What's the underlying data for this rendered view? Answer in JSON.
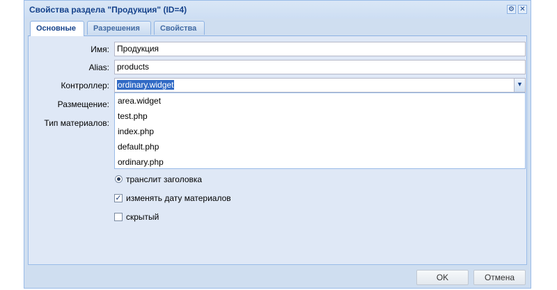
{
  "window": {
    "title": "Свойства раздела \"Продукция\" (ID=4)",
    "tools": {
      "gear": "⚙",
      "close": "✕"
    }
  },
  "tabs": [
    {
      "label": "Основные",
      "active": true
    },
    {
      "label": "Разрешения",
      "active": false
    },
    {
      "label": "Свойства",
      "active": false
    }
  ],
  "form": {
    "name_label": "Имя:",
    "name_value": "Продукция",
    "alias_label": "Alias:",
    "alias_value": "products",
    "controller_label": "Контроллер:",
    "controller_value": "ordinary.widget",
    "placement_label": "Размещение:",
    "material_type_label": "Тип материалов:"
  },
  "dropdown": {
    "options": [
      "area.widget",
      "test.php",
      "index.php",
      "default.php",
      "ordinary.php"
    ]
  },
  "options": {
    "translit_label": "транслит заголовка",
    "translit_checked": true,
    "change_date_label": "изменять дату материалов",
    "change_date_checked": true,
    "hidden_label": "скрытый",
    "hidden_checked": false
  },
  "buttons": {
    "ok": "OK",
    "cancel": "Отмена"
  },
  "colors": {
    "titlebar_text": "#15428b",
    "panel_bg": "#dfe8f6",
    "frame_border": "#99bbe8",
    "selection": "#316ac5"
  }
}
